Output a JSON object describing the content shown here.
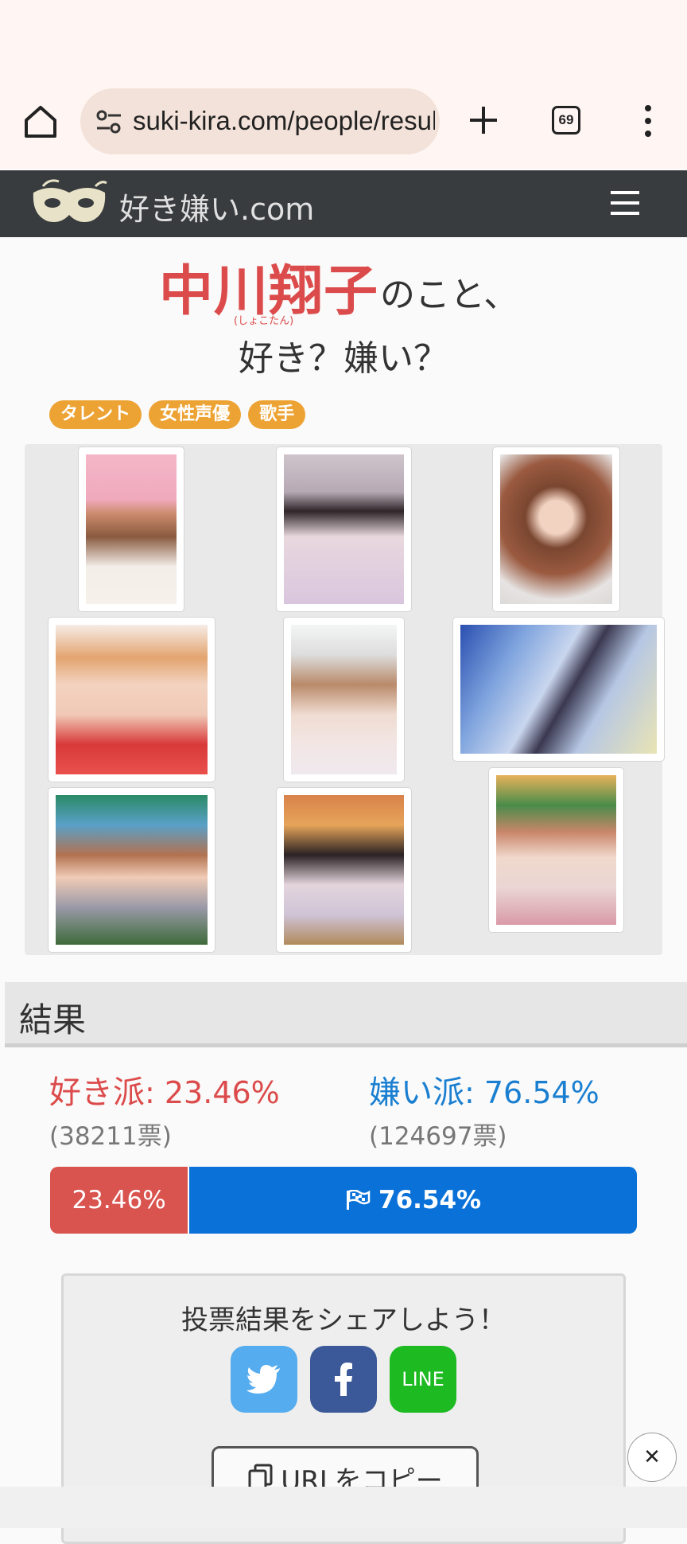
{
  "browser": {
    "url": "suki-kira.com/people/result/中川翔子",
    "tab_count": "69"
  },
  "site": {
    "logo_text": "好き嫌い.com"
  },
  "person": {
    "name": "中川翔子",
    "ruby": "(しょこたん)",
    "suffix": "のこと、",
    "question": "好き？嫌い？"
  },
  "tags": [
    "タレント",
    "女性声優",
    "歌手"
  ],
  "result": {
    "heading": "結果",
    "like_label": "好き派",
    "like_pct_text": ": 23.46%",
    "like_votes": "(38211票)",
    "dislike_label": "嫌い派",
    "dislike_pct_text": ": 76.54%",
    "dislike_votes": "(124697票)",
    "bar_like": "23.46%",
    "bar_dislike": "76.54%",
    "like_fraction": 0.2346
  },
  "share": {
    "prompt": "投票結果をシェアしよう！",
    "line_label": "LINE",
    "copy_label": "URLをコピー"
  },
  "colors": {
    "like": "#dc4b4b",
    "dislike": "#0a71d8",
    "tag": "#eda334",
    "header": "#383c3e"
  }
}
